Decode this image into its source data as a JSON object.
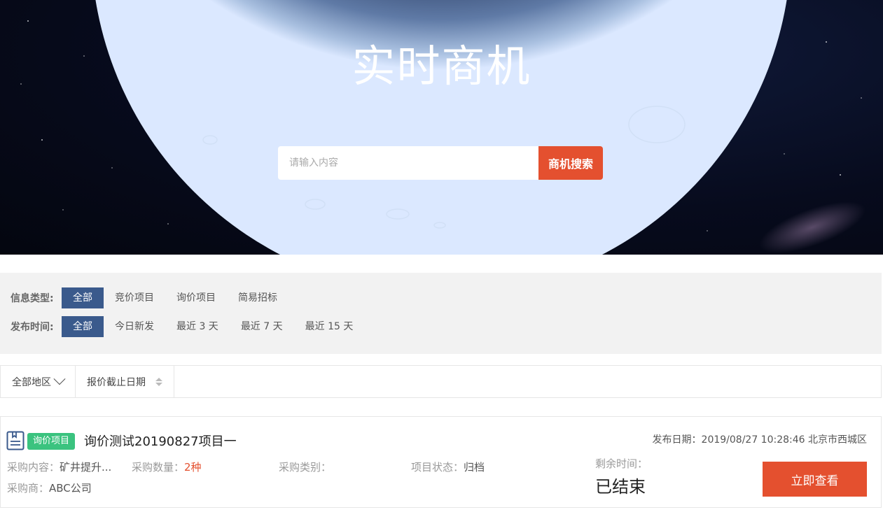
{
  "hero": {
    "title": "实时商机",
    "search_placeholder": "请输入内容",
    "search_button": "商机搜索"
  },
  "filters": {
    "info_type": {
      "label": "信息类型:",
      "options": [
        "全部",
        "竞价项目",
        "询价项目",
        "简易招标"
      ],
      "selected": "全部"
    },
    "publish_time": {
      "label": "发布时间:",
      "options": [
        "全部",
        "今日新发",
        "最近 3 天",
        "最近 7 天",
        "最近 15 天"
      ],
      "selected": "全部"
    }
  },
  "sort_bar": {
    "region": "全部地区",
    "deadline": "报价截止日期"
  },
  "listing": {
    "tag": "询价项目",
    "title": "询价测试20190827项目一",
    "date_line": "发布日期：2019/08/27 10:28:46 北京市西城区",
    "content_label": "采购内容：",
    "content_value": "矿井提升...",
    "quantity_label": "采购数量：",
    "quantity_value": "2种",
    "category_label": "采购类别：",
    "category_value": "",
    "status_label": "项目状态：",
    "status_value": "归档",
    "buyer_label": "采购商：",
    "buyer_value": "ABC公司",
    "remaining_label": "剩余时间：",
    "remaining_value": "已结束",
    "view_button": "立即查看"
  },
  "colors": {
    "accent": "#e4502f",
    "filter_active": "#3a5a8c",
    "tag_green": "#3bc37f"
  }
}
